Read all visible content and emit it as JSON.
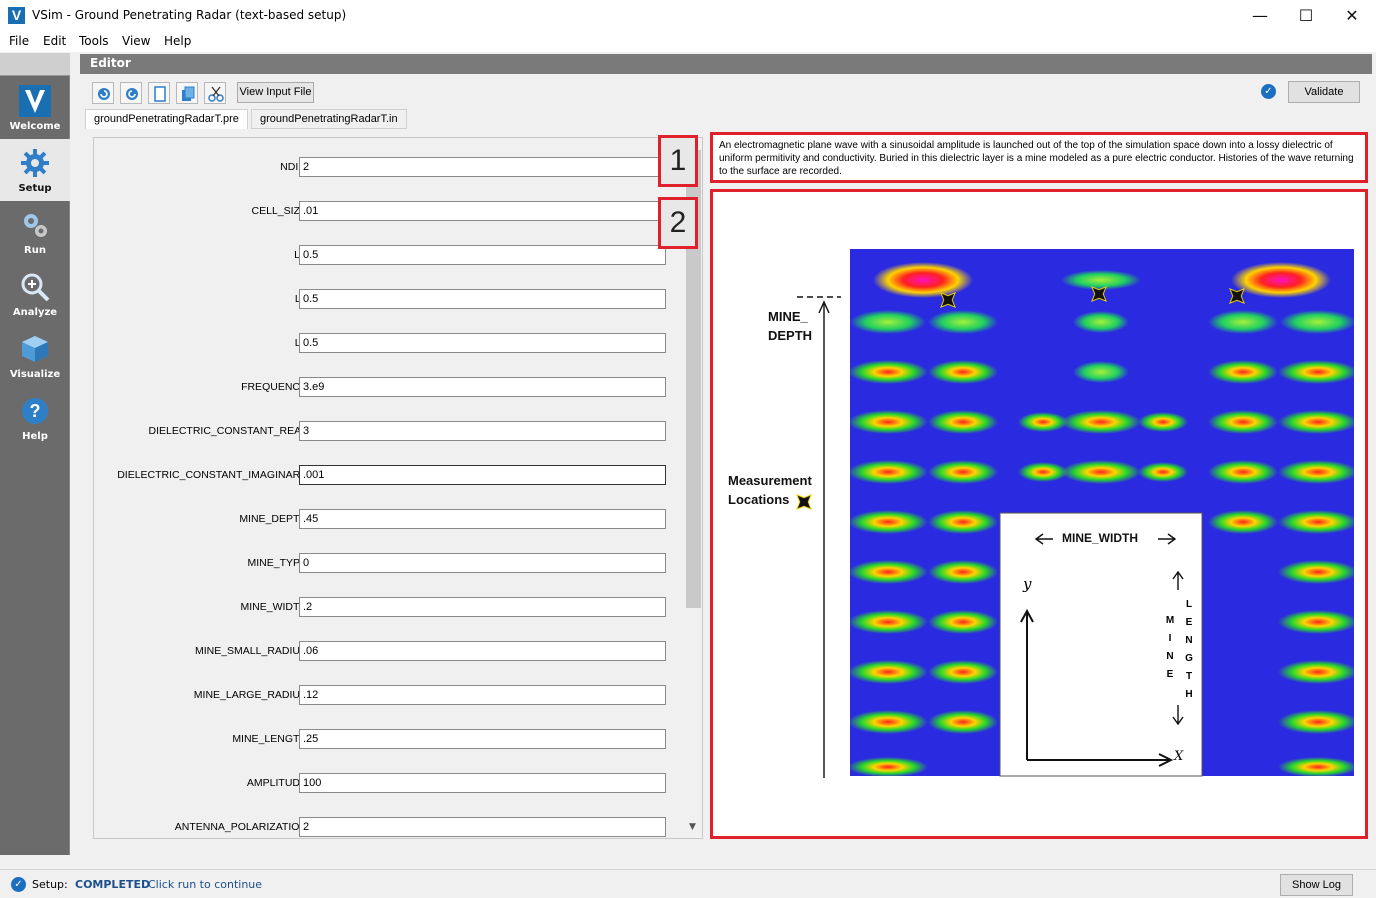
{
  "window": {
    "title": "VSim - Ground Penetrating Radar (text-based setup)",
    "logo_letter": "V",
    "controls": [
      "—",
      "☐",
      "✕"
    ]
  },
  "menu": [
    "File",
    "Edit",
    "Tools",
    "View",
    "Help"
  ],
  "nav": [
    {
      "label": "Welcome",
      "icon": "vsim-logo-icon"
    },
    {
      "label": "Setup",
      "icon": "gear-icon"
    },
    {
      "label": "Run",
      "icon": "gears-icon"
    },
    {
      "label": "Analyze",
      "icon": "magnifier-icon"
    },
    {
      "label": "Visualize",
      "icon": "cube-icon"
    },
    {
      "label": "Help",
      "icon": "question-icon"
    }
  ],
  "editor": {
    "title": "Editor",
    "view_input_label": "View Input File",
    "validate_label": "Validate",
    "tabs": [
      "groundPenetratingRadarT.pre",
      "groundPenetratingRadarT.in"
    ]
  },
  "form": [
    {
      "label": "NDIM",
      "value": "2"
    },
    {
      "label": "CELL_SIZE",
      "value": ".01"
    },
    {
      "label": "LX",
      "value": "0.5"
    },
    {
      "label": "LY",
      "value": "0.5"
    },
    {
      "label": "LZ",
      "value": "0.5"
    },
    {
      "label": "FREQUENCY",
      "value": "3.e9"
    },
    {
      "label": "DIELECTRIC_CONSTANT_REAL",
      "value": "3"
    },
    {
      "label": "DIELECTRIC_CONSTANT_IMAGINARY",
      "value": ".001"
    },
    {
      "label": "MINE_DEPTH",
      "value": ".45"
    },
    {
      "label": "MINE_TYPE",
      "value": "0"
    },
    {
      "label": "MINE_WIDTH",
      "value": ".2"
    },
    {
      "label": "MINE_SMALL_RADIUS",
      "value": ".06"
    },
    {
      "label": "MINE_LARGE_RADIUS",
      "value": ".12"
    },
    {
      "label": "MINE_LENGTH",
      "value": ".25"
    },
    {
      "label": "AMPLITUDE",
      "value": "100"
    },
    {
      "label": "ANTENNA_POLARIZATION",
      "value": "2"
    }
  ],
  "badges": [
    "1",
    "2"
  ],
  "description": "An electromagnetic plane wave with a sinusoidal amplitude is launched out of the top of the simulation space down into a lossy dielectric of uniform permitivity and conductivity. Buried in this dielectric layer is a mine modeled as a pure electric conductor. Histories of the wave returning to the surface are recorded.",
  "figure": {
    "mine_depth_label_1": "MINE_",
    "mine_depth_label_2": "DEPTH",
    "measurement_label_1": "Measurement",
    "measurement_label_2": "Locations",
    "mine_width_label": "MINE_WIDTH",
    "mine_vertical": [
      "M",
      "I",
      "N",
      "E"
    ],
    "length_vertical": [
      "L",
      "E",
      "N",
      "G",
      "T",
      "H"
    ],
    "axis_x": "X",
    "axis_y": "y"
  },
  "status": {
    "label": "Setup:",
    "state": "COMPLETED",
    "message": "Click run to continue",
    "show_log_label": "Show Log"
  },
  "colors": {
    "accent_red": "#e0202a",
    "nav_bg": "#6b6b6b",
    "status_blue": "#1c6fc0"
  }
}
